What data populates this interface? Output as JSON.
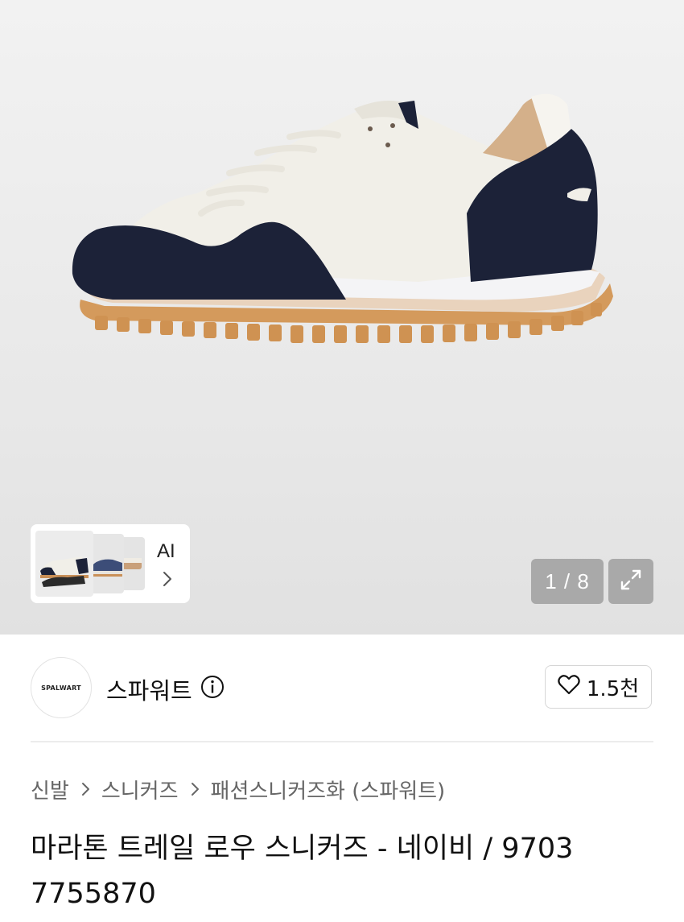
{
  "gallery": {
    "ai_badge": "AI",
    "counter": "1/8",
    "counter_display": "1 / 8"
  },
  "brand": {
    "logo_text": "SPALWART",
    "name": "스파워트",
    "likes": "1.5천"
  },
  "breadcrumb": [
    "신발",
    "스니커즈",
    "패션스니커즈화 (스파워트)"
  ],
  "product": {
    "title": "마라톤 트레일 로우 스니커즈 - 네이비 / 9703 7755870"
  },
  "icons": {
    "info": "info-circle-icon",
    "heart": "heart-icon",
    "expand": "expand-icon",
    "chevron": "chevron-right-icon"
  },
  "colors": {
    "navy_suede": "#1c2238",
    "cream_upper": "#f1efe8",
    "gum_sole": "#d49a5c",
    "overlay_button": "#a9a9a9"
  }
}
